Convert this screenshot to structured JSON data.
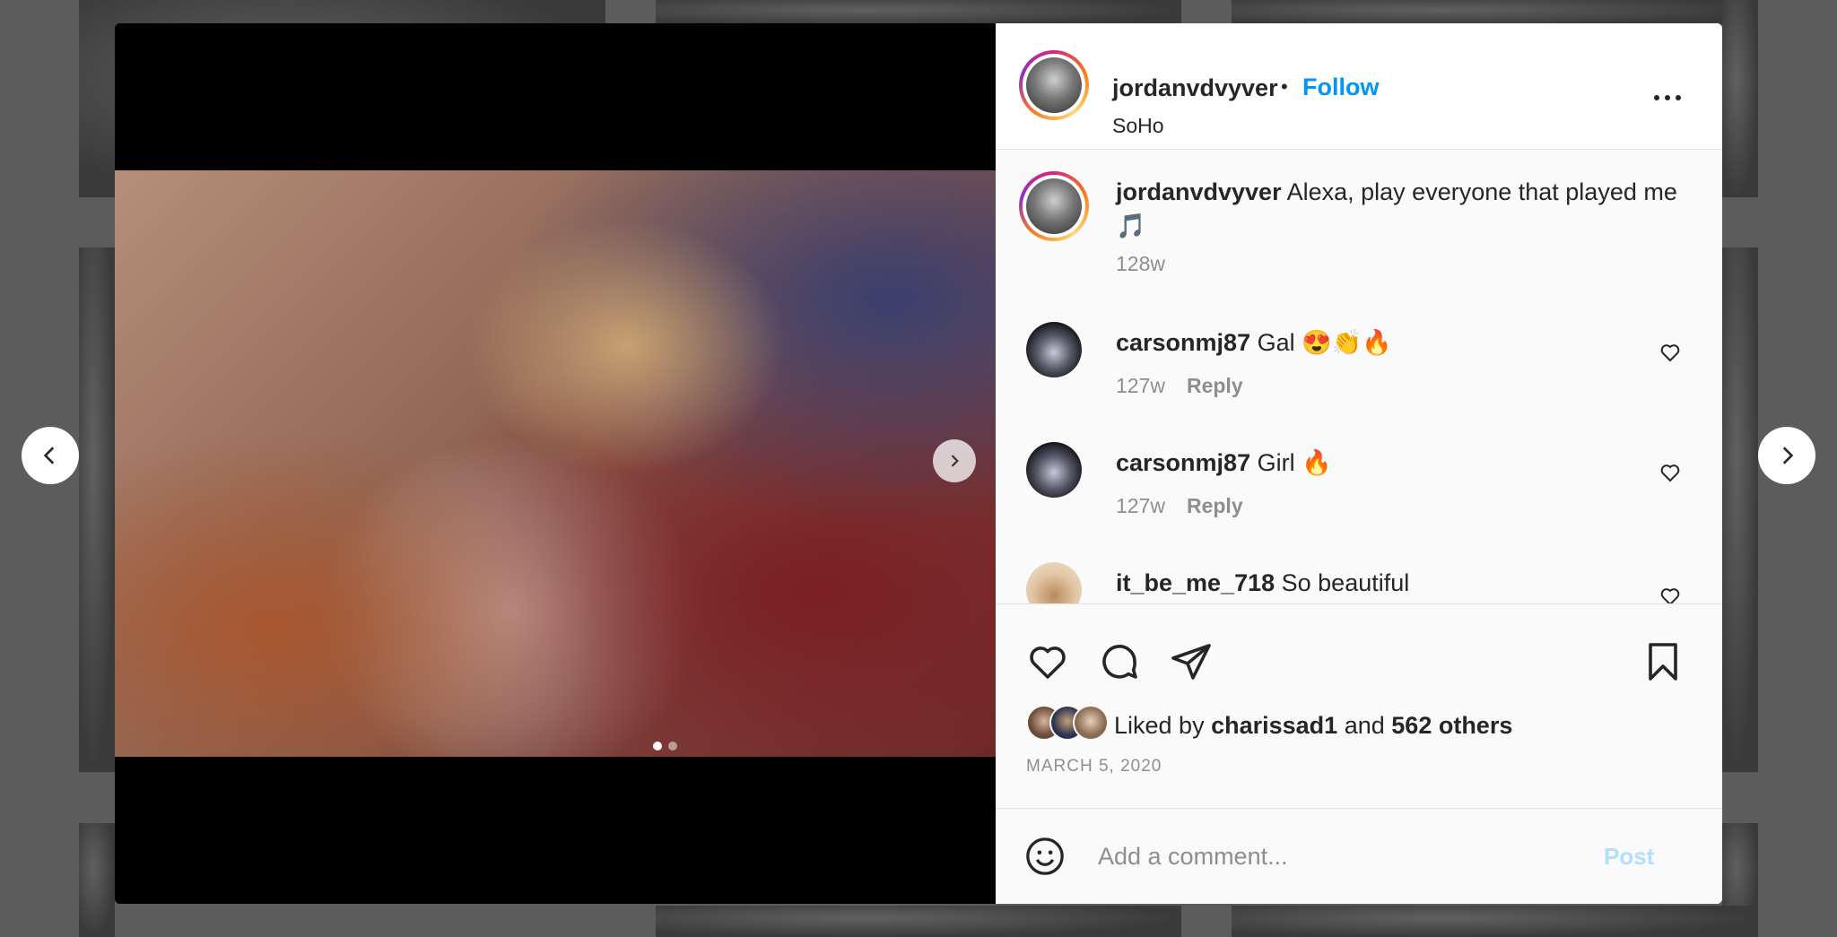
{
  "post": {
    "username": "jordanvdvyver",
    "separator": "•",
    "follow_label": "Follow",
    "location": "SoHo",
    "caption_text": "Alexa, play everyone that played me 🎵",
    "caption_time": "128w"
  },
  "comments": [
    {
      "username": "carsonmj87",
      "text": "Gal 😍👏🔥",
      "time": "127w",
      "reply_label": "Reply"
    },
    {
      "username": "carsonmj87",
      "text": "Girl 🔥",
      "time": "127w",
      "reply_label": "Reply"
    },
    {
      "username": "it_be_me_718",
      "text": "So beautiful",
      "time": "",
      "reply_label": ""
    }
  ],
  "likes": {
    "prefix": "Liked by",
    "first_user": "charissad1",
    "conjunction": "and",
    "others": "562 others"
  },
  "date": "MARCH 5, 2020",
  "add_comment": {
    "placeholder": "Add a comment...",
    "post_label": "Post"
  },
  "carousel": {
    "current_slide": 1,
    "total_slides": 2
  },
  "colors": {
    "accent": "#0095f6",
    "post_disabled": "#b2dffc",
    "text": "#262626",
    "muted": "#8e8e8e"
  },
  "icons": [
    "chevron-left-icon",
    "chevron-right-icon",
    "more-icon",
    "heart-icon",
    "comment-icon",
    "share-icon",
    "bookmark-icon",
    "emoji-icon"
  ]
}
